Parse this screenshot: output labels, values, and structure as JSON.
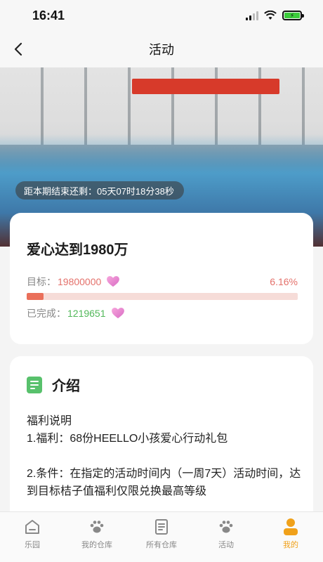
{
  "status_bar": {
    "time": "16:41"
  },
  "nav": {
    "title": "活动"
  },
  "banner": {
    "countdown_label": "距本期结束还剩：05天07时18分38秒"
  },
  "progress": {
    "title": "爱心达到1980万",
    "goal_label": "目标：",
    "goal_value": "19800000",
    "percent_text": "6.16%",
    "percent": 6.16,
    "done_label": "已完成：",
    "done_value": "1219651"
  },
  "intro": {
    "title": "介绍",
    "lines": [
      "福利说明",
      "1.福利：68份HEELLO小孩爱心行动礼包",
      "",
      "2.条件：在指定的活动时间内（一周7天）活动时间，达到目标桔子值福利仅限兑换最高等级"
    ]
  },
  "tabs": [
    {
      "label": "乐园",
      "icon": "home-icon",
      "active": false
    },
    {
      "label": "我的仓库",
      "icon": "paw-icon",
      "active": false
    },
    {
      "label": "所有仓库",
      "icon": "list-icon",
      "active": false
    },
    {
      "label": "活动",
      "icon": "paw-icon",
      "active": false
    },
    {
      "label": "我的",
      "icon": "person-icon",
      "active": true
    }
  ],
  "colors": {
    "accent": "#f0a11a",
    "progress_fill": "#ea6f5a",
    "progress_track": "#f6dcd8",
    "goal_value": "#e4716b",
    "done_value": "#52b85a",
    "intro_icon": "#58c16c"
  }
}
